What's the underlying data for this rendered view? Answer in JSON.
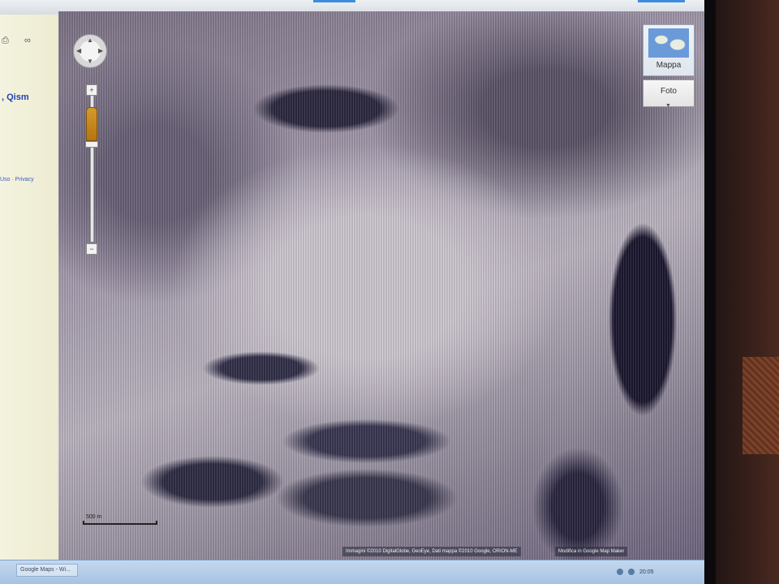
{
  "left_panel": {
    "result_title": ", Qism",
    "terms_links": "Uso · Privacy"
  },
  "map": {
    "zoom_in_label": "+",
    "zoom_out_label": "−",
    "map_type_map_label": "Mappa",
    "map_type_photo_label": "Foto",
    "scale_label": "500 m",
    "attribution": "Immagini ©2010 DigitalGlobe, GeoEye, Dati mappa ©2010 Google, ORION-ME",
    "report_link": "Modifica in Google Map Maker"
  },
  "taskbar": {
    "item_label": "Google Maps - Wi...",
    "clock": "20:05"
  },
  "colors": {
    "accent": "#3c8de0",
    "link": "#2240b8"
  }
}
